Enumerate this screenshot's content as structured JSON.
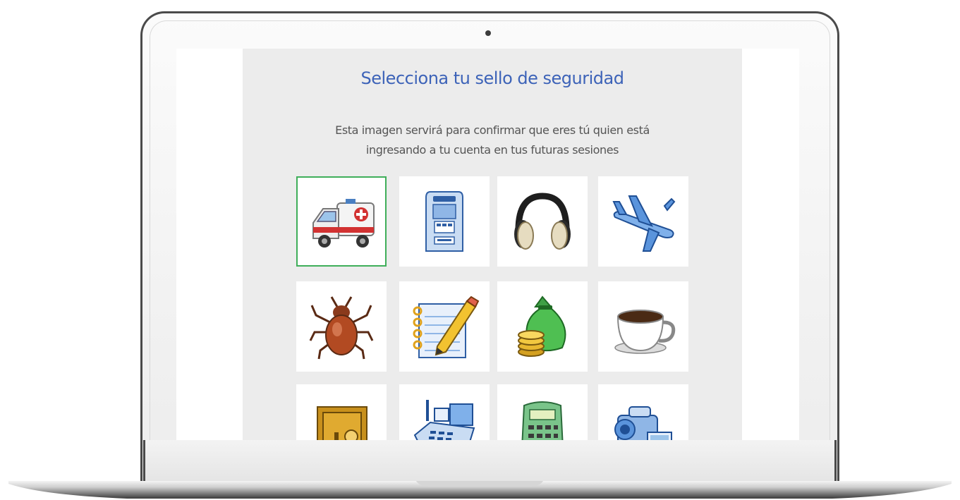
{
  "page": {
    "title": "Selecciona tu sello de seguridad",
    "description_line1": "Esta imagen servirá para confirmar que eres tú quien está",
    "description_line2": "ingresando a tu cuenta en tus futuras sesiones"
  },
  "seals": [
    {
      "icon": "ambulance-icon",
      "selected": true
    },
    {
      "icon": "atm-machine-icon",
      "selected": false
    },
    {
      "icon": "headphones-icon",
      "selected": false
    },
    {
      "icon": "airplane-icon",
      "selected": false
    },
    {
      "icon": "bug-icon",
      "selected": false
    },
    {
      "icon": "notepad-pencil-icon",
      "selected": false
    },
    {
      "icon": "money-bag-coins-icon",
      "selected": false
    },
    {
      "icon": "coffee-cup-icon",
      "selected": false
    },
    {
      "icon": "safe-icon",
      "selected": false
    },
    {
      "icon": "cash-register-icon",
      "selected": false
    },
    {
      "icon": "calculator-icon",
      "selected": false
    },
    {
      "icon": "video-camera-icon",
      "selected": false
    }
  ],
  "colors": {
    "title": "#3d63b8",
    "text": "#555555",
    "panel": "#ececec",
    "selected_border": "#3fae5a"
  }
}
